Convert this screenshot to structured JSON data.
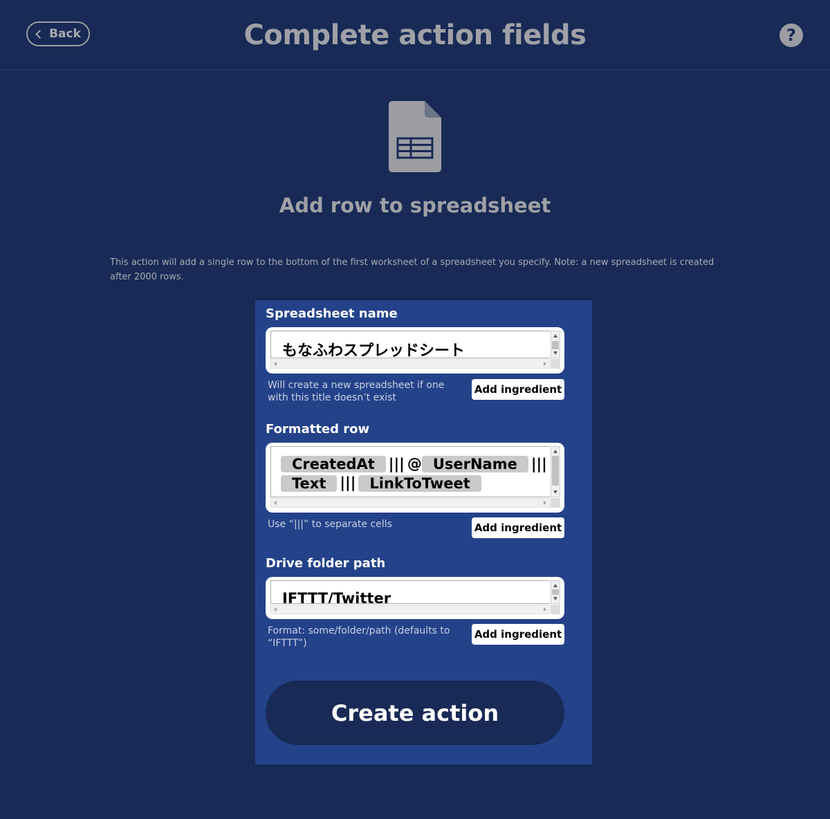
{
  "header": {
    "back_label": "Back",
    "title": "Complete action fields",
    "help_glyph": "?"
  },
  "service": {
    "icon": "spreadsheet-icon",
    "action_title": "Add row to spreadsheet",
    "description": "This action will add a single row to the bottom of the first worksheet of a spreadsheet you specify. Note: a new spreadsheet is created after 2000 rows."
  },
  "fields": {
    "spreadsheet_name": {
      "label": "Spreadsheet name",
      "value": "もなふわスプレッドシート",
      "help": "Will create a new spreadsheet if one with this title doesn’t exist",
      "add_ingredient": "Add ingredient"
    },
    "formatted_row": {
      "label": "Formatted row",
      "ingredients": [
        "CreatedAt",
        "UserName",
        "Text",
        "LinkToTweet"
      ],
      "separator": "|||",
      "at_sign": "@",
      "help": "Use “|||” to separate cells",
      "add_ingredient": "Add ingredient"
    },
    "drive_folder_path": {
      "label": "Drive folder path",
      "value": "IFTTT/Twitter",
      "help": "Format: some/folder/path (defaults to “IFTTT”)",
      "add_ingredient": "Add ingredient"
    }
  },
  "create_button": "Create action",
  "colors": {
    "page_bg": "#182a55",
    "panel_bg": "#23428a",
    "muted_text": "#9fa1a6",
    "button_bg": "#182a55"
  }
}
